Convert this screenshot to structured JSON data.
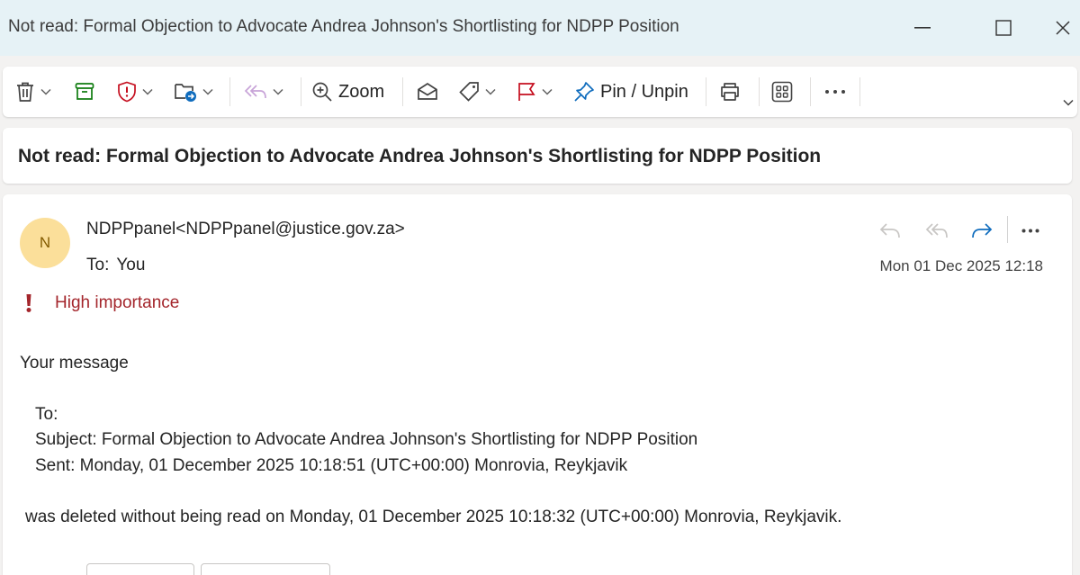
{
  "window": {
    "title": "Not read: Formal Objection to Advocate Andrea Johnson's Shortlisting for NDPP Position"
  },
  "toolbar": {
    "zoom_label": "Zoom",
    "pin_label": "Pin / Unpin",
    "icons": [
      "delete-icon",
      "archive-icon",
      "report-icon",
      "move-icon",
      "reply-all-icon",
      "zoom-icon",
      "mark-read-icon",
      "tag-icon",
      "flag-icon",
      "pin-icon",
      "print-icon",
      "apps-icon",
      "more-icon",
      "expand-icon"
    ]
  },
  "subject_bar": {
    "subject": "Not read: Formal Objection to Advocate Andrea Johnson's Shortlisting for NDPP Position"
  },
  "message": {
    "avatar_initial": "N",
    "sender": "NDPPpanel<NDPPpanel@justice.gov.za>",
    "to_label": "To:",
    "to_value": "You",
    "date": "Mon 01 Dec 2025 12:18",
    "importance": "High importance",
    "body": {
      "line1": "Your message",
      "to_line": "To:",
      "subject_line": "Subject: Formal Objection to Advocate Andrea Johnson's Shortlisting for NDPP Position",
      "sent_line": "Sent: Monday, 01 December 2025 10:18:51 (UTC+00:00) Monrovia, Reykjavik",
      "deleted_line": "was deleted without being read on Monday, 01 December 2025 10:18:32 (UTC+00:00) Monrovia, Reykjavik."
    }
  },
  "colors": {
    "titlebar_bg": "#e6f2f6",
    "importance": "#a4262c",
    "avatar_bg": "#fbdf9a",
    "avatar_text": "#835b00",
    "accent_blue": "#0f6cbd"
  }
}
